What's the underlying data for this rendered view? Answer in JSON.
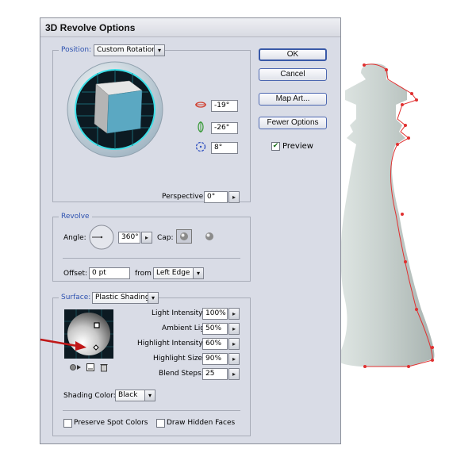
{
  "dialog": {
    "title": "3D Revolve Options"
  },
  "position": {
    "legend": "Position:",
    "preset": "Custom Rotation",
    "x_rotation": "-19°",
    "y_rotation": "-26°",
    "z_rotation": "8°",
    "perspective_label": "Perspective:",
    "perspective_value": "0°"
  },
  "revolve": {
    "legend": "Revolve",
    "angle_label": "Angle:",
    "angle_value": "360°",
    "cap_label": "Cap:",
    "offset_label": "Offset:",
    "offset_value": "0 pt",
    "from_label": "from",
    "from_value": "Left Edge"
  },
  "surface": {
    "legend": "Surface:",
    "type": "Plastic Shading",
    "light_intensity_label": "Light Intensity:",
    "light_intensity_value": "100%",
    "ambient_light_label": "Ambient Light:",
    "ambient_light_value": "50%",
    "highlight_intensity_label": "Highlight Intensity:",
    "highlight_intensity_value": "60%",
    "highlight_size_label": "Highlight Size:",
    "highlight_size_value": "90%",
    "blend_steps_label": "Blend Steps:",
    "blend_steps_value": "25",
    "shading_color_label": "Shading Color:",
    "shading_color_value": "Black",
    "preserve_spot_label": "Preserve Spot Colors",
    "draw_hidden_label": "Draw Hidden Faces"
  },
  "buttons": {
    "ok": "OK",
    "cancel": "Cancel",
    "map_art": "Map Art...",
    "fewer_options": "Fewer Options",
    "preview_label": "Preview",
    "preview_checked": true
  },
  "colors": {
    "dialog_bg": "#d9dce6",
    "legend_blue": "#2e52b0",
    "cube_front": "#5ba8c2",
    "path_red": "#e03030",
    "chess_piece": "#c9d2cf"
  },
  "icons": [
    "x-rotation-icon",
    "y-rotation-icon",
    "z-rotation-icon",
    "cap-on-icon",
    "cap-off-icon",
    "new-light-icon",
    "light-to-back-icon",
    "delete-light-icon",
    "checkmark-icon"
  ]
}
